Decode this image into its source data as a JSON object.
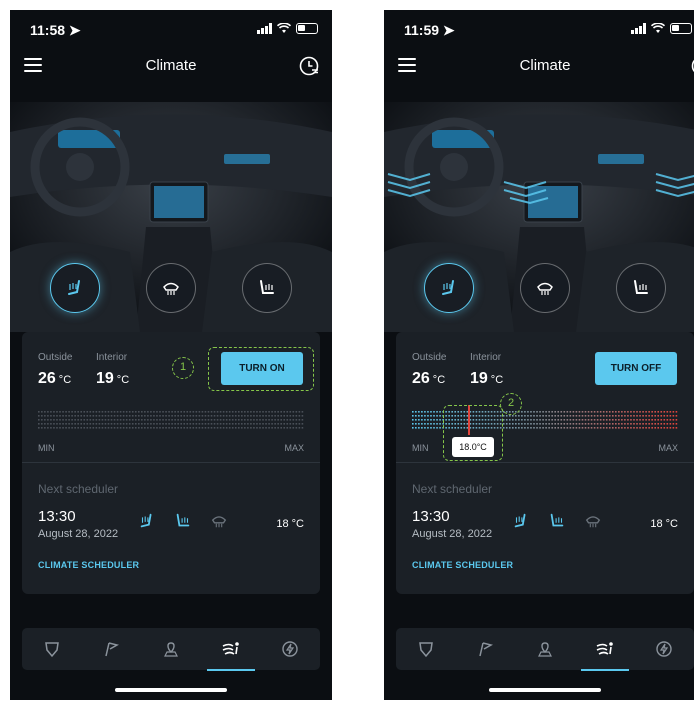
{
  "screens": [
    {
      "status": {
        "time": "11:58"
      },
      "header": {
        "title": "Climate"
      },
      "climate": {
        "outside_label": "Outside",
        "outside_value": "26",
        "outside_unit": "°C",
        "interior_label": "Interior",
        "interior_value": "19",
        "interior_unit": "°C",
        "button_label": "TURN ON",
        "min_label": "MIN",
        "max_label": "MAX",
        "annotation": "1"
      },
      "scheduler": {
        "title": "Next scheduler",
        "time": "13:30",
        "date": "August 28, 2022",
        "temperature": "18 °C",
        "link": "CLIMATE SCHEDULER"
      }
    },
    {
      "status": {
        "time": "11:59"
      },
      "header": {
        "title": "Climate"
      },
      "climate": {
        "outside_label": "Outside",
        "outside_value": "26",
        "outside_unit": "°C",
        "interior_label": "Interior",
        "interior_value": "19",
        "interior_unit": "°C",
        "button_label": "TURN OFF",
        "min_label": "MIN",
        "max_label": "MAX",
        "set_temperature": "18.0°C",
        "annotation": "2"
      },
      "scheduler": {
        "title": "Next scheduler",
        "time": "13:30",
        "date": "August 28, 2022",
        "temperature": "18 °C",
        "link": "CLIMATE SCHEDULER"
      }
    }
  ],
  "colors": {
    "accent": "#5bc8ee",
    "annotation": "#86c64a",
    "cold": "#5bc8ee",
    "hot": "#e0443c"
  },
  "icons": {
    "seat_controls": [
      "heated-seat-icon",
      "defrost-icon",
      "rear-seat-heat-icon"
    ],
    "tabs": [
      "shield-icon",
      "flag-icon",
      "map-pin-icon",
      "climate-fan-icon",
      "charging-icon"
    ]
  }
}
